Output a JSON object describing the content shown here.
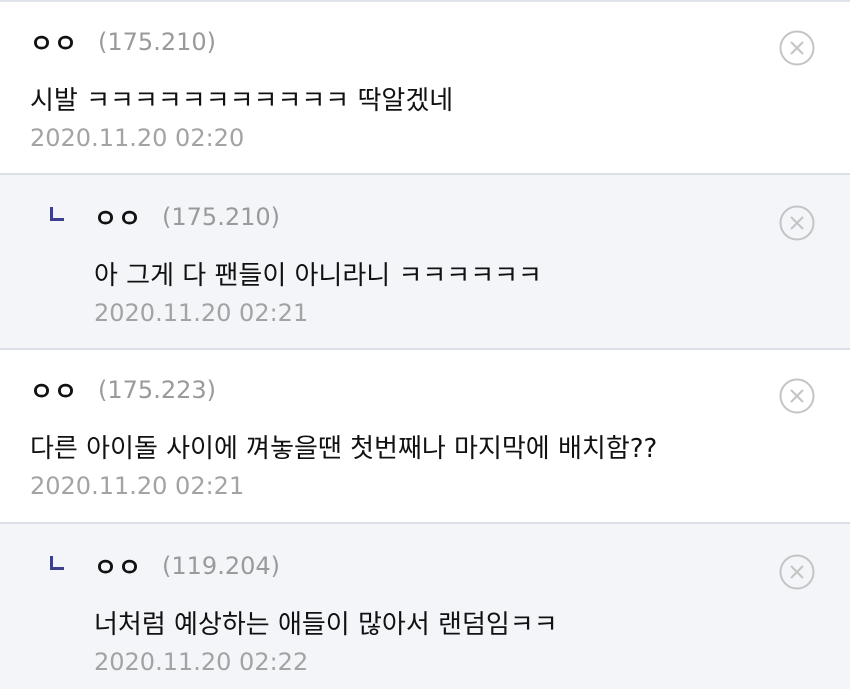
{
  "comments": [
    {
      "nick": "ㅇㅇ",
      "ip": "(175.210)",
      "text": "시발 ㅋㅋㅋㅋㅋㅋㅋㅋㅋㅋㅋ 딱알겠네",
      "date": "2020.11.20 02:20",
      "is_reply": false
    },
    {
      "nick": "ㅇㅇ",
      "ip": "(175.210)",
      "text": "아 그게 다 팬들이 아니라니 ㅋㅋㅋㅋㅋㅋ",
      "date": "2020.11.20 02:21",
      "is_reply": true
    },
    {
      "nick": "ㅇㅇ",
      "ip": "(175.223)",
      "text": "다른 아이돌 사이에 껴놓을땐 첫번째나 마지막에 배치함??",
      "date": "2020.11.20 02:21",
      "is_reply": false
    },
    {
      "nick": "ㅇㅇ",
      "ip": "(119.204)",
      "text": "너처럼 예상하는 애들이 많아서 랜덤임ㅋㅋ",
      "date": "2020.11.20 02:22",
      "is_reply": true
    }
  ],
  "icons": {
    "delete": "delete-icon",
    "reply": "reply-arrow-icon"
  },
  "colors": {
    "reply_background": "#f4f5f9",
    "reply_mark": "#3b3f8c",
    "meta_text": "#a3a3a3",
    "divider": "#dcdfe8"
  }
}
